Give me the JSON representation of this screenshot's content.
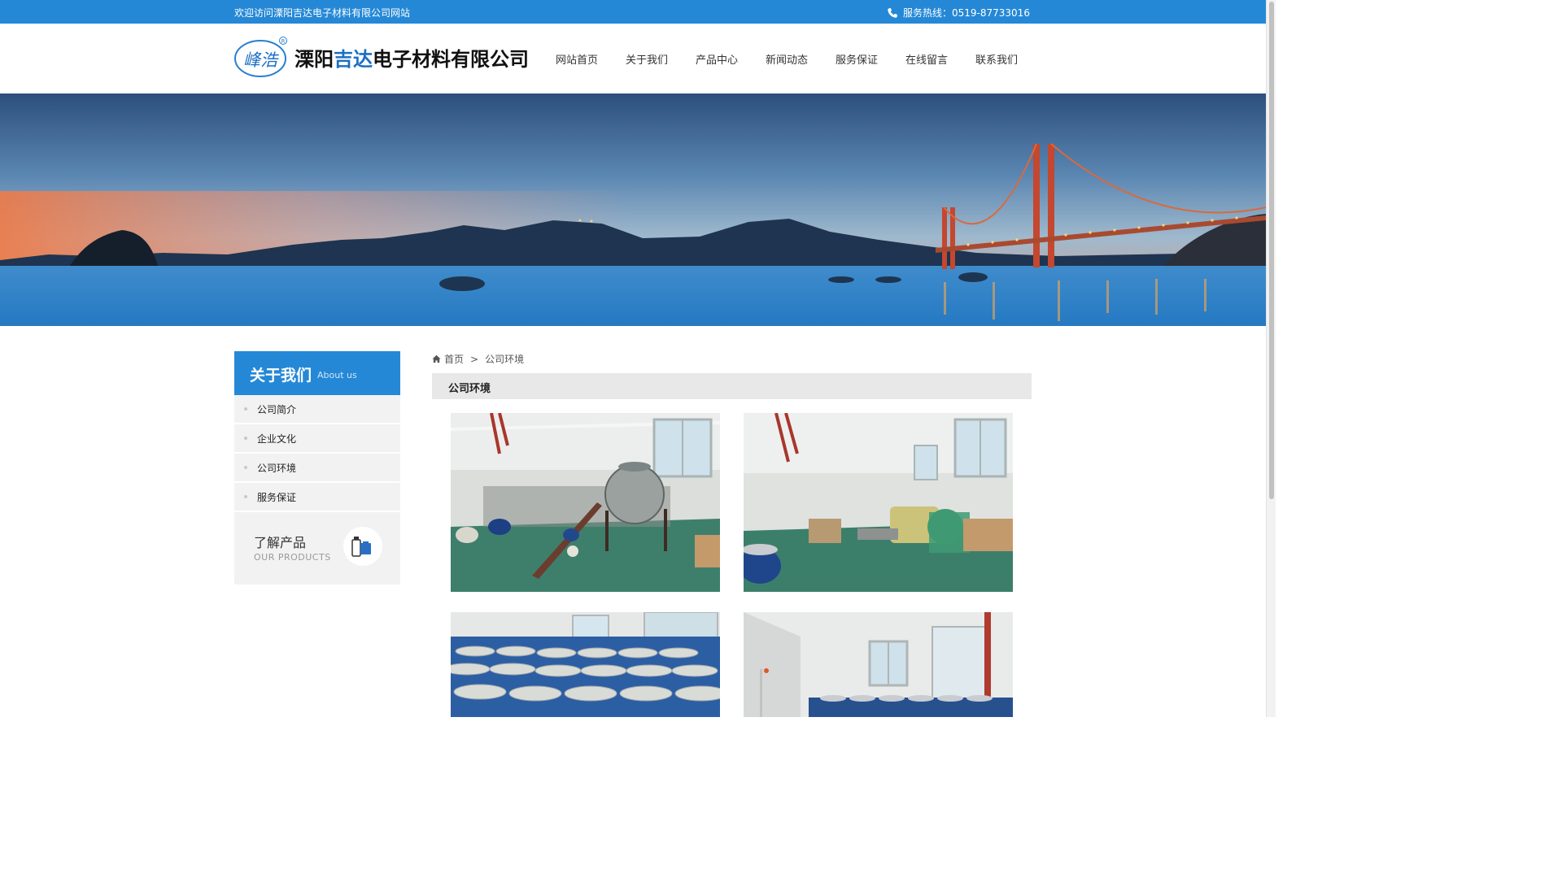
{
  "topbar": {
    "welcome": "欢迎访问溧阳吉达电子材料有限公司网站",
    "hotline": "服务热线：0519-87733016",
    "icon": "phone-icon"
  },
  "header": {
    "logo_mark_text": "峰浩",
    "registered": "®",
    "company_name_part1": "溧阳",
    "company_name_part2": "吉达",
    "company_name_part3": "电子材料有限公司"
  },
  "nav": [
    {
      "label": "网站首页"
    },
    {
      "label": "关于我们"
    },
    {
      "label": "产品中心"
    },
    {
      "label": "新闻动态"
    },
    {
      "label": "服务保证"
    },
    {
      "label": "在线留言"
    },
    {
      "label": "联系我们"
    }
  ],
  "sidebar": {
    "title_cn": "关于我们",
    "title_en": "About us",
    "items": [
      {
        "label": "公司简介"
      },
      {
        "label": "企业文化"
      },
      {
        "label": "公司环境"
      },
      {
        "label": "服务保证"
      }
    ],
    "products_cn": "了解产品",
    "products_en": "OUR  PRODUCTS"
  },
  "breadcrumb": {
    "home": "首页",
    "separator": ">",
    "current": "公司环境"
  },
  "section_title": "公司环境",
  "colors": {
    "brand_blue": "#2588d6",
    "grey_panel": "#f2f2f2",
    "title_bar": "#e8e8e8"
  }
}
